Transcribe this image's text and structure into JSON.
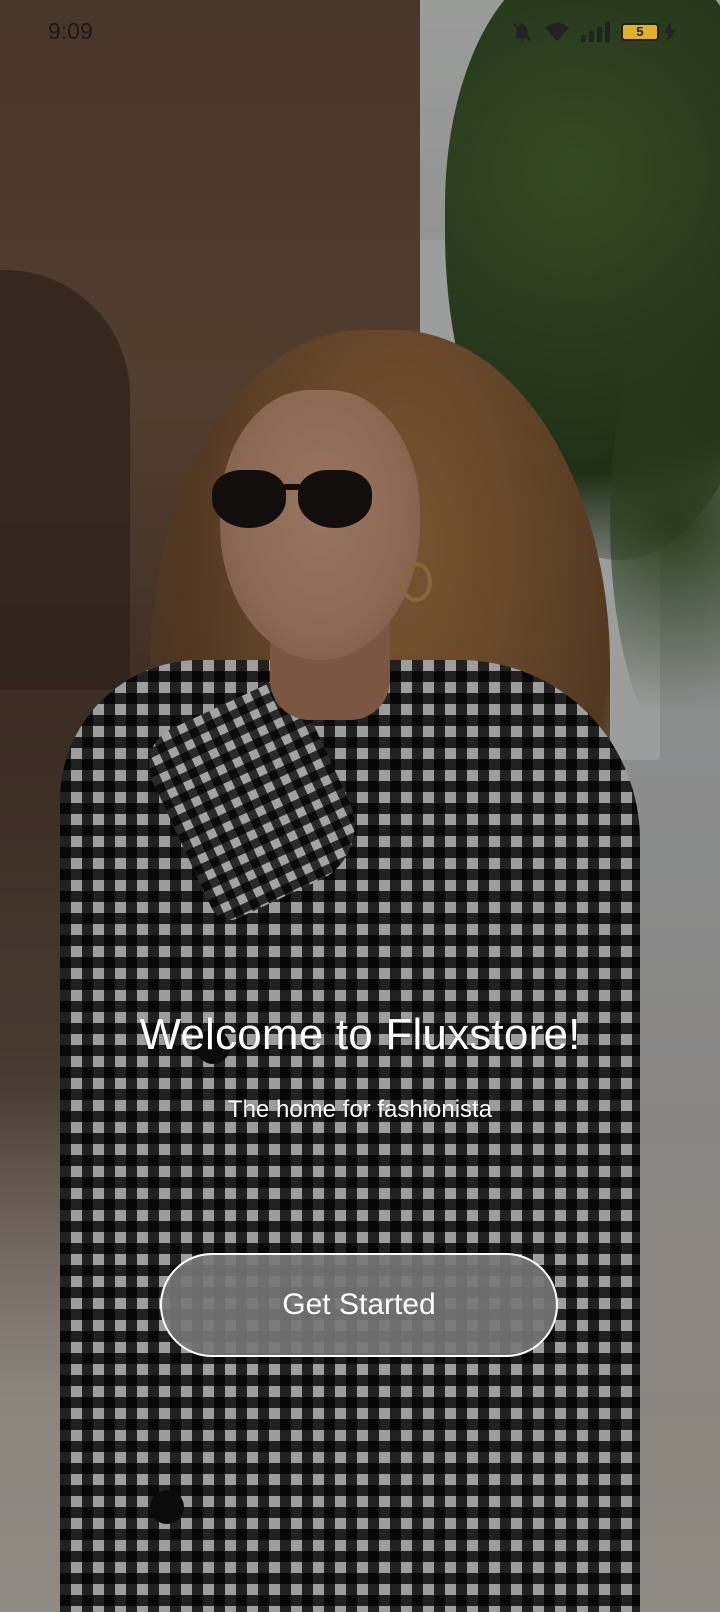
{
  "status_bar": {
    "time": "9:09",
    "battery_level": "5",
    "icons": [
      "bell-off-icon",
      "wifi-icon",
      "signal-icon",
      "battery-icon",
      "charging-bolt-icon"
    ]
  },
  "welcome": {
    "title": "Welcome to Fluxstore!",
    "subtitle": "The home for fashionista"
  },
  "cta": {
    "label": "Get Started"
  },
  "colors": {
    "overlay": "#00000052",
    "button_fill": "#787878",
    "button_border": "#ffffff",
    "text": "#ffffff",
    "battery": "#e0b227"
  }
}
